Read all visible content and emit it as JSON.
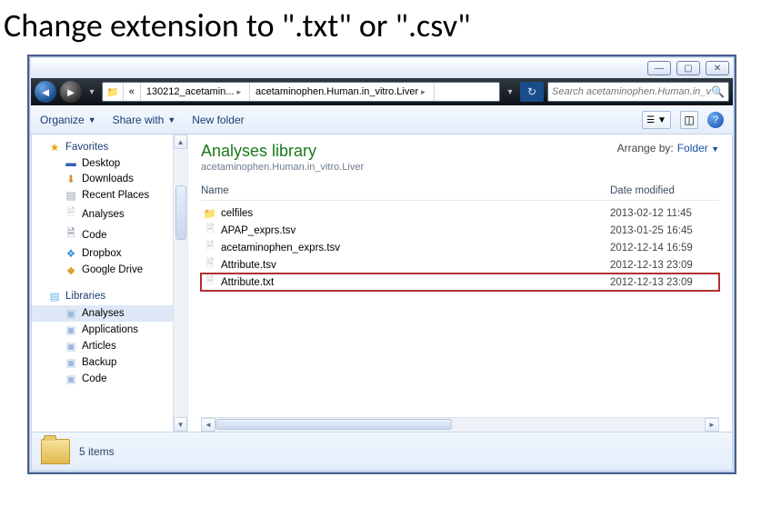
{
  "slide_title": "Change extension to \".txt\" or \".csv\"",
  "window_buttons": {
    "min": "—",
    "max": "▢",
    "close": "✕"
  },
  "address": {
    "segments": [
      "130212_acetamin...",
      "acetaminophen.Human.in_vitro.Liver"
    ],
    "chevrons_prefix": "«"
  },
  "search": {
    "placeholder": "Search acetaminophen.Human.in_vitr..."
  },
  "toolbar": {
    "organize": "Organize",
    "share": "Share with",
    "newfolder": "New folder"
  },
  "sidebar": {
    "favorites_label": "Favorites",
    "favorites": [
      {
        "label": "Desktop",
        "icon": "ic-desktop",
        "glyph": "▬"
      },
      {
        "label": "Downloads",
        "icon": "ic-dl",
        "glyph": "⬇"
      },
      {
        "label": "Recent Places",
        "icon": "ic-rec",
        "glyph": "▤"
      },
      {
        "label": "Analyses",
        "icon": "ic-an",
        "glyph": "🗎"
      },
      {
        "label": "Code",
        "icon": "ic-code",
        "glyph": "🗎"
      },
      {
        "label": "Dropbox",
        "icon": "ic-drop",
        "glyph": "❖"
      },
      {
        "label": "Google Drive",
        "icon": "ic-gd",
        "glyph": "◆"
      }
    ],
    "libraries_label": "Libraries",
    "libraries": [
      {
        "label": "Analyses",
        "selected": true
      },
      {
        "label": "Applications"
      },
      {
        "label": "Articles"
      },
      {
        "label": "Backup"
      },
      {
        "label": "Code"
      }
    ]
  },
  "main": {
    "title": "Analyses library",
    "subtitle": "acetaminophen.Human.in_vitro.Liver",
    "arrange_label": "Arrange by:",
    "arrange_value": "Folder",
    "columns": {
      "name": "Name",
      "date": "Date modified"
    },
    "files": [
      {
        "name": "celfiles",
        "date": "2013-02-12 11:45",
        "type": "folder"
      },
      {
        "name": "APAP_exprs.tsv",
        "date": "2013-01-25 16:45",
        "type": "doc"
      },
      {
        "name": "acetaminophen_exprs.tsv",
        "date": "2012-12-14 16:59",
        "type": "doc"
      },
      {
        "name": "Attribute.tsv",
        "date": "2012-12-13 23:09",
        "type": "doc"
      },
      {
        "name": "Attribute.txt",
        "date": "2012-12-13 23:09",
        "type": "doc",
        "highlight": true
      }
    ]
  },
  "status": {
    "count_text": "5 items"
  }
}
